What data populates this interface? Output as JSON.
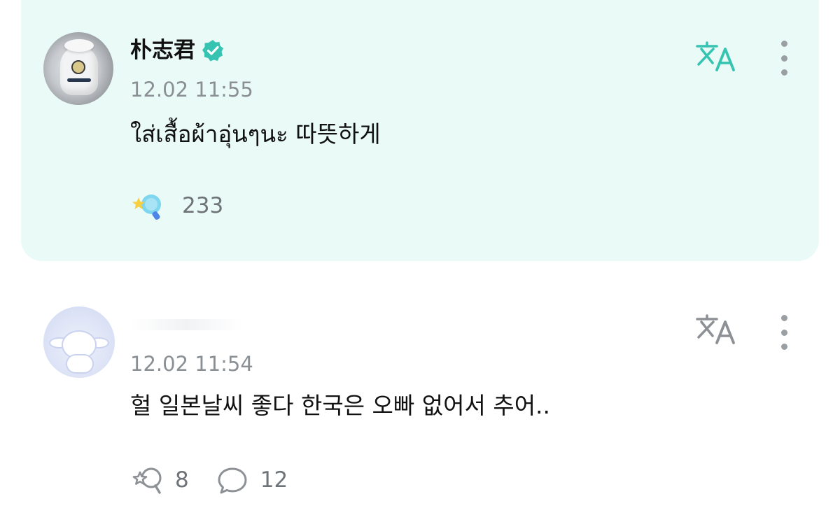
{
  "post": {
    "author_name": "朴志君",
    "timestamp": "12.02 11:55",
    "text": "ใส่เสื้อผ้าอุ่นๆนะ 따뜻하게",
    "reaction_count": "233",
    "verified_icon": "verified-badge-icon",
    "translate_icon": "translate-icon",
    "more_icon": "more-vertical-icon"
  },
  "comment": {
    "timestamp": "12.02 11:54",
    "text": "헐 일본날씨 좋다 한국은 오빠 없어서 추어..",
    "like_count": "8",
    "reply_count": "12",
    "translate_icon": "translate-icon",
    "more_icon": "more-vertical-icon"
  },
  "colors": {
    "highlight_bg": "#eafbf7",
    "accent": "#36c3b1",
    "muted_text": "#8a8f94",
    "count_text": "#6e7378"
  }
}
